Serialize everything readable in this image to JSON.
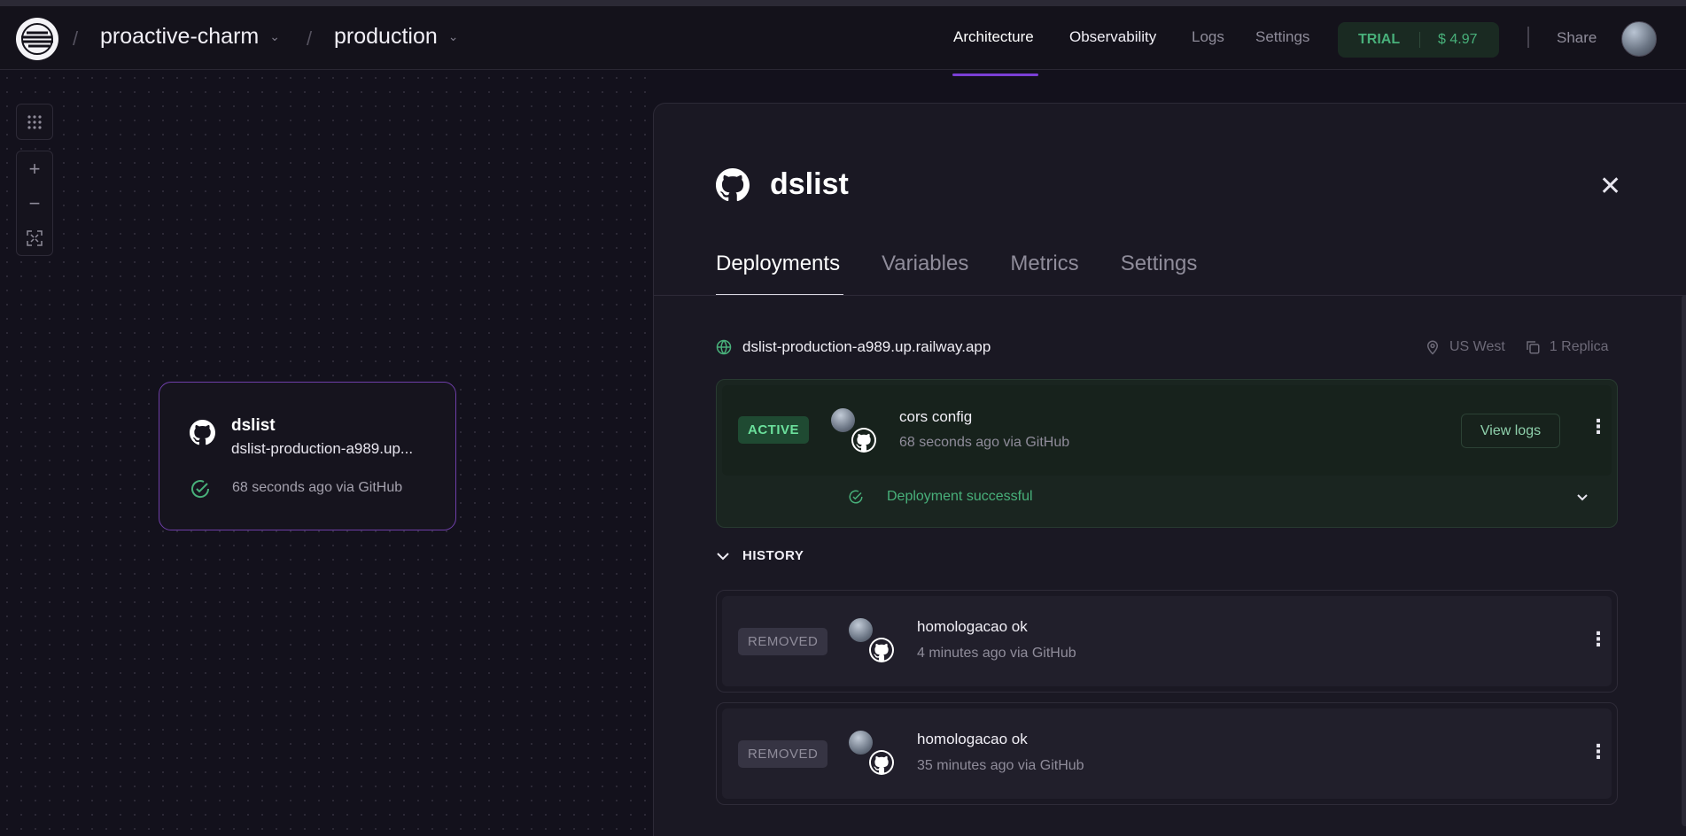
{
  "header": {
    "project": "proactive-charm",
    "environment": "production",
    "nav": [
      "Architecture",
      "Observability",
      "Logs",
      "Settings"
    ],
    "trial_label": "TRIAL",
    "trial_amount": "$ 4.97",
    "share": "Share"
  },
  "node": {
    "name": "dslist",
    "url": "dslist-production-a989.up...",
    "status": "68 seconds ago via GitHub"
  },
  "panel": {
    "title": "dslist",
    "tabs": [
      "Deployments",
      "Variables",
      "Metrics",
      "Settings"
    ],
    "domain": "dslist-production-a989.up.railway.app",
    "region": "US West",
    "replicas": "1 Replica",
    "active": {
      "badge": "ACTIVE",
      "commit": "cors config",
      "meta": "68 seconds ago via GitHub",
      "view_logs": "View logs",
      "status": "Deployment successful"
    },
    "history_label": "HISTORY",
    "history": [
      {
        "badge": "REMOVED",
        "commit": "homologacao ok",
        "meta": "4 minutes ago via GitHub"
      },
      {
        "badge": "REMOVED",
        "commit": "homologacao ok",
        "meta": "35 minutes ago via GitHub"
      }
    ]
  },
  "icons": [
    "railway-logo-icon",
    "chevron-down-icon",
    "grid-icon",
    "plus-icon",
    "minus-icon",
    "fit-view-icon",
    "github-icon",
    "check-circle-icon",
    "close-icon",
    "globe-icon",
    "location-pin-icon",
    "copy-icon",
    "kebab-menu-icon"
  ],
  "colors": {
    "accent": "#7b3fd6",
    "success": "#48b07a",
    "active_badge": "#1f4a32"
  }
}
